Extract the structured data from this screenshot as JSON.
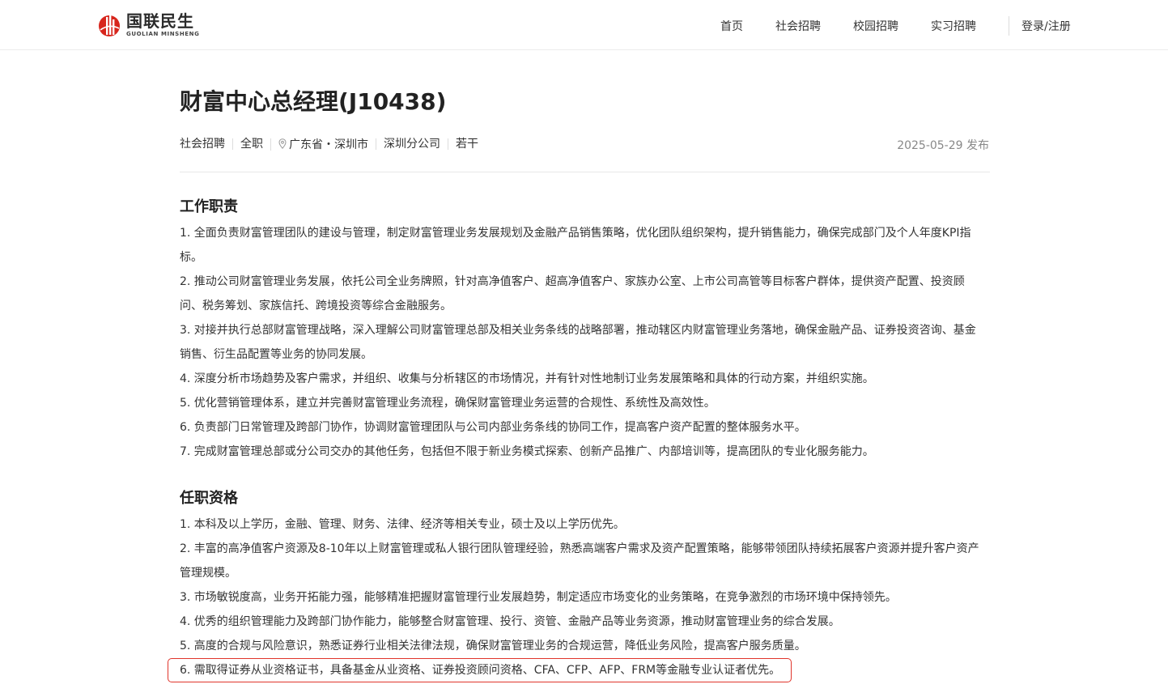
{
  "header": {
    "logo_cn": "国联民生",
    "logo_en": "GUOLIAN MINSHENG",
    "nav": [
      "首页",
      "社会招聘",
      "校园招聘",
      "实习招聘"
    ],
    "login": "登录/注册"
  },
  "job": {
    "title": "财富中心总经理(J10438)",
    "tags": [
      "社会招聘",
      "全职",
      "广东省・深圳市",
      "深圳分公司",
      "若干"
    ],
    "date": "2025-05-29 发布"
  },
  "responsibilities": {
    "heading": "工作职责",
    "items": [
      "1. 全面负责财富管理团队的建设与管理，制定财富管理业务发展规划及金融产品销售策略，优化团队组织架构，提升销售能力，确保完成部门及个人年度KPI指标。",
      "2. 推动公司财富管理业务发展，依托公司全业务牌照，针对高净值客户、超高净值客户、家族办公室、上市公司高管等目标客户群体，提供资产配置、投资顾问、税务筹划、家族信托、跨境投资等综合金融服务。",
      "3. 对接并执行总部财富管理战略，深入理解公司财富管理总部及相关业务条线的战略部署，推动辖区内财富管理业务落地，确保金融产品、证券投资咨询、基金销售、衍生品配置等业务的协同发展。",
      "4. 深度分析市场趋势及客户需求，并组织、收集与分析辖区的市场情况，并有针对性地制订业务发展策略和具体的行动方案，并组织实施。",
      "5. 优化营销管理体系，建立并完善财富管理业务流程，确保财富管理业务运营的合规性、系统性及高效性。",
      "6. 负责部门日常管理及跨部门协作，协调财富管理团队与公司内部业务条线的协同工作，提高客户资产配置的整体服务水平。",
      "7. 完成财富管理总部或分公司交办的其他任务，包括但不限于新业务模式探索、创新产品推广、内部培训等，提高团队的专业化服务能力。"
    ]
  },
  "qualifications": {
    "heading": "任职资格",
    "items": [
      "1. 本科及以上学历，金融、管理、财务、法律、经济等相关专业，硕士及以上学历优先。",
      "2. 丰富的高净值客户资源及8-10年以上财富管理或私人银行团队管理经验，熟悉高端客户需求及资产配置策略，能够带领团队持续拓展客户资源并提升客户资产管理规模。",
      "3. 市场敏锐度高，业务开拓能力强，能够精准把握财富管理行业发展趋势，制定适应市场变化的业务策略，在竞争激烈的市场环境中保持领先。",
      "4. 优秀的组织管理能力及跨部门协作能力，能够整合财富管理、投行、资管、金融产品等业务资源，推动财富管理业务的综合发展。",
      "5. 高度的合规与风险意识，熟悉证券行业相关法律法规，确保财富管理业务的合规运营，降低业务风险，提高客户服务质量。",
      "6. 需取得证券从业资格证书，具备基金从业资格、证券投资顾问资格、CFA、CFP、AFP、FRM等金融专业认证者优先。"
    ]
  },
  "colors": {
    "brand_red": "#d7261d",
    "highlight_border": "#e0352b"
  },
  "icons": {
    "location": "location-pin-icon"
  }
}
